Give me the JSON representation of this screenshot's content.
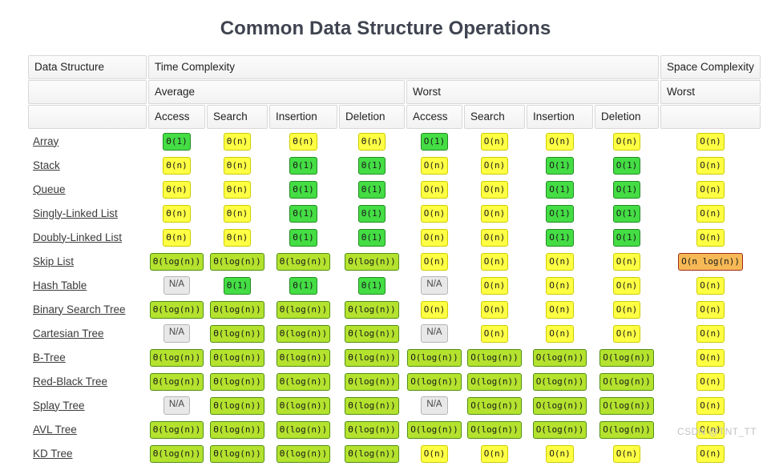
{
  "title": "Common Data Structure Operations",
  "watermark": "CSDN @TNT_TT",
  "header": {
    "col_data_structure": "Data Structure",
    "group_time": "Time Complexity",
    "group_space": "Space Complexity",
    "sub_average": "Average",
    "sub_worst_time": "Worst",
    "sub_worst_space": "Worst",
    "ops": [
      "Access",
      "Search",
      "Insertion",
      "Deletion",
      "Access",
      "Search",
      "Insertion",
      "Deletion"
    ],
    "blank": ""
  },
  "legend_colors": {
    "constant": "#44dd44",
    "logarithmic": "#b4e22e",
    "linear": "#ffff44",
    "linearithmic": "#f7b955",
    "not_applicable": "#e8e8e8"
  },
  "chart_data": {
    "type": "table",
    "title": "Common Data Structure Operations",
    "column_groups": [
      {
        "label": "Data Structure",
        "span": 1
      },
      {
        "label": "Time Complexity",
        "span": 8
      },
      {
        "label": "Space Complexity",
        "span": 1
      }
    ],
    "sub_groups": [
      "",
      "Average",
      "Worst",
      "Worst"
    ],
    "columns": [
      "Data Structure",
      "Average Access",
      "Average Search",
      "Average Insertion",
      "Average Deletion",
      "Worst Access",
      "Worst Search",
      "Worst Insertion",
      "Worst Deletion",
      "Worst Space"
    ],
    "rows": [
      {
        "name": "Array",
        "cells": [
          {
            "text": "Θ(1)",
            "class": "c-const"
          },
          {
            "text": "Θ(n)",
            "class": "c-lin"
          },
          {
            "text": "Θ(n)",
            "class": "c-lin"
          },
          {
            "text": "Θ(n)",
            "class": "c-lin"
          },
          {
            "text": "O(1)",
            "class": "c-const"
          },
          {
            "text": "O(n)",
            "class": "c-lin"
          },
          {
            "text": "O(n)",
            "class": "c-lin"
          },
          {
            "text": "O(n)",
            "class": "c-lin"
          },
          {
            "text": "O(n)",
            "class": "c-lin"
          }
        ]
      },
      {
        "name": "Stack",
        "cells": [
          {
            "text": "Θ(n)",
            "class": "c-lin"
          },
          {
            "text": "Θ(n)",
            "class": "c-lin"
          },
          {
            "text": "Θ(1)",
            "class": "c-const"
          },
          {
            "text": "Θ(1)",
            "class": "c-const"
          },
          {
            "text": "O(n)",
            "class": "c-lin"
          },
          {
            "text": "O(n)",
            "class": "c-lin"
          },
          {
            "text": "O(1)",
            "class": "c-const"
          },
          {
            "text": "O(1)",
            "class": "c-const"
          },
          {
            "text": "O(n)",
            "class": "c-lin"
          }
        ]
      },
      {
        "name": "Queue",
        "cells": [
          {
            "text": "Θ(n)",
            "class": "c-lin"
          },
          {
            "text": "Θ(n)",
            "class": "c-lin"
          },
          {
            "text": "Θ(1)",
            "class": "c-const"
          },
          {
            "text": "Θ(1)",
            "class": "c-const"
          },
          {
            "text": "O(n)",
            "class": "c-lin"
          },
          {
            "text": "O(n)",
            "class": "c-lin"
          },
          {
            "text": "O(1)",
            "class": "c-const"
          },
          {
            "text": "O(1)",
            "class": "c-const"
          },
          {
            "text": "O(n)",
            "class": "c-lin"
          }
        ]
      },
      {
        "name": "Singly-Linked List",
        "cells": [
          {
            "text": "Θ(n)",
            "class": "c-lin"
          },
          {
            "text": "Θ(n)",
            "class": "c-lin"
          },
          {
            "text": "Θ(1)",
            "class": "c-const"
          },
          {
            "text": "Θ(1)",
            "class": "c-const"
          },
          {
            "text": "O(n)",
            "class": "c-lin"
          },
          {
            "text": "O(n)",
            "class": "c-lin"
          },
          {
            "text": "O(1)",
            "class": "c-const"
          },
          {
            "text": "O(1)",
            "class": "c-const"
          },
          {
            "text": "O(n)",
            "class": "c-lin"
          }
        ]
      },
      {
        "name": "Doubly-Linked List",
        "cells": [
          {
            "text": "Θ(n)",
            "class": "c-lin"
          },
          {
            "text": "Θ(n)",
            "class": "c-lin"
          },
          {
            "text": "Θ(1)",
            "class": "c-const"
          },
          {
            "text": "Θ(1)",
            "class": "c-const"
          },
          {
            "text": "O(n)",
            "class": "c-lin"
          },
          {
            "text": "O(n)",
            "class": "c-lin"
          },
          {
            "text": "O(1)",
            "class": "c-const"
          },
          {
            "text": "O(1)",
            "class": "c-const"
          },
          {
            "text": "O(n)",
            "class": "c-lin"
          }
        ]
      },
      {
        "name": "Skip List",
        "cells": [
          {
            "text": "Θ(log(n))",
            "class": "c-log"
          },
          {
            "text": "Θ(log(n))",
            "class": "c-log"
          },
          {
            "text": "Θ(log(n))",
            "class": "c-log"
          },
          {
            "text": "Θ(log(n))",
            "class": "c-log"
          },
          {
            "text": "O(n)",
            "class": "c-lin"
          },
          {
            "text": "O(n)",
            "class": "c-lin"
          },
          {
            "text": "O(n)",
            "class": "c-lin"
          },
          {
            "text": "O(n)",
            "class": "c-lin"
          },
          {
            "text": "O(n log(n))",
            "class": "c-nlogn"
          }
        ]
      },
      {
        "name": "Hash Table",
        "cells": [
          {
            "text": "N/A",
            "class": "c-na"
          },
          {
            "text": "Θ(1)",
            "class": "c-const"
          },
          {
            "text": "Θ(1)",
            "class": "c-const"
          },
          {
            "text": "Θ(1)",
            "class": "c-const"
          },
          {
            "text": "N/A",
            "class": "c-na"
          },
          {
            "text": "O(n)",
            "class": "c-lin"
          },
          {
            "text": "O(n)",
            "class": "c-lin"
          },
          {
            "text": "O(n)",
            "class": "c-lin"
          },
          {
            "text": "O(n)",
            "class": "c-lin"
          }
        ]
      },
      {
        "name": "Binary Search Tree",
        "cells": [
          {
            "text": "Θ(log(n))",
            "class": "c-log"
          },
          {
            "text": "Θ(log(n))",
            "class": "c-log"
          },
          {
            "text": "Θ(log(n))",
            "class": "c-log"
          },
          {
            "text": "Θ(log(n))",
            "class": "c-log"
          },
          {
            "text": "O(n)",
            "class": "c-lin"
          },
          {
            "text": "O(n)",
            "class": "c-lin"
          },
          {
            "text": "O(n)",
            "class": "c-lin"
          },
          {
            "text": "O(n)",
            "class": "c-lin"
          },
          {
            "text": "O(n)",
            "class": "c-lin"
          }
        ]
      },
      {
        "name": "Cartesian Tree",
        "cells": [
          {
            "text": "N/A",
            "class": "c-na"
          },
          {
            "text": "Θ(log(n))",
            "class": "c-log"
          },
          {
            "text": "Θ(log(n))",
            "class": "c-log"
          },
          {
            "text": "Θ(log(n))",
            "class": "c-log"
          },
          {
            "text": "N/A",
            "class": "c-na"
          },
          {
            "text": "O(n)",
            "class": "c-lin"
          },
          {
            "text": "O(n)",
            "class": "c-lin"
          },
          {
            "text": "O(n)",
            "class": "c-lin"
          },
          {
            "text": "O(n)",
            "class": "c-lin"
          }
        ]
      },
      {
        "name": "B-Tree",
        "cells": [
          {
            "text": "Θ(log(n))",
            "class": "c-log"
          },
          {
            "text": "Θ(log(n))",
            "class": "c-log"
          },
          {
            "text": "Θ(log(n))",
            "class": "c-log"
          },
          {
            "text": "Θ(log(n))",
            "class": "c-log"
          },
          {
            "text": "O(log(n))",
            "class": "c-log"
          },
          {
            "text": "O(log(n))",
            "class": "c-log"
          },
          {
            "text": "O(log(n))",
            "class": "c-log"
          },
          {
            "text": "O(log(n))",
            "class": "c-log"
          },
          {
            "text": "O(n)",
            "class": "c-lin"
          }
        ]
      },
      {
        "name": "Red-Black Tree",
        "cells": [
          {
            "text": "Θ(log(n))",
            "class": "c-log"
          },
          {
            "text": "Θ(log(n))",
            "class": "c-log"
          },
          {
            "text": "Θ(log(n))",
            "class": "c-log"
          },
          {
            "text": "Θ(log(n))",
            "class": "c-log"
          },
          {
            "text": "O(log(n))",
            "class": "c-log"
          },
          {
            "text": "O(log(n))",
            "class": "c-log"
          },
          {
            "text": "O(log(n))",
            "class": "c-log"
          },
          {
            "text": "O(log(n))",
            "class": "c-log"
          },
          {
            "text": "O(n)",
            "class": "c-lin"
          }
        ]
      },
      {
        "name": "Splay Tree",
        "cells": [
          {
            "text": "N/A",
            "class": "c-na"
          },
          {
            "text": "Θ(log(n))",
            "class": "c-log"
          },
          {
            "text": "Θ(log(n))",
            "class": "c-log"
          },
          {
            "text": "Θ(log(n))",
            "class": "c-log"
          },
          {
            "text": "N/A",
            "class": "c-na"
          },
          {
            "text": "O(log(n))",
            "class": "c-log"
          },
          {
            "text": "O(log(n))",
            "class": "c-log"
          },
          {
            "text": "O(log(n))",
            "class": "c-log"
          },
          {
            "text": "O(n)",
            "class": "c-lin"
          }
        ]
      },
      {
        "name": "AVL Tree",
        "cells": [
          {
            "text": "Θ(log(n))",
            "class": "c-log"
          },
          {
            "text": "Θ(log(n))",
            "class": "c-log"
          },
          {
            "text": "Θ(log(n))",
            "class": "c-log"
          },
          {
            "text": "Θ(log(n))",
            "class": "c-log"
          },
          {
            "text": "O(log(n))",
            "class": "c-log"
          },
          {
            "text": "O(log(n))",
            "class": "c-log"
          },
          {
            "text": "O(log(n))",
            "class": "c-log"
          },
          {
            "text": "O(log(n))",
            "class": "c-log"
          },
          {
            "text": "O(n)",
            "class": "c-lin"
          }
        ]
      },
      {
        "name": "KD Tree",
        "cells": [
          {
            "text": "Θ(log(n))",
            "class": "c-log"
          },
          {
            "text": "Θ(log(n))",
            "class": "c-log"
          },
          {
            "text": "Θ(log(n))",
            "class": "c-log"
          },
          {
            "text": "Θ(log(n))",
            "class": "c-log"
          },
          {
            "text": "O(n)",
            "class": "c-lin"
          },
          {
            "text": "O(n)",
            "class": "c-lin"
          },
          {
            "text": "O(n)",
            "class": "c-lin"
          },
          {
            "text": "O(n)",
            "class": "c-lin"
          },
          {
            "text": "O(n)",
            "class": "c-lin"
          }
        ]
      }
    ]
  }
}
